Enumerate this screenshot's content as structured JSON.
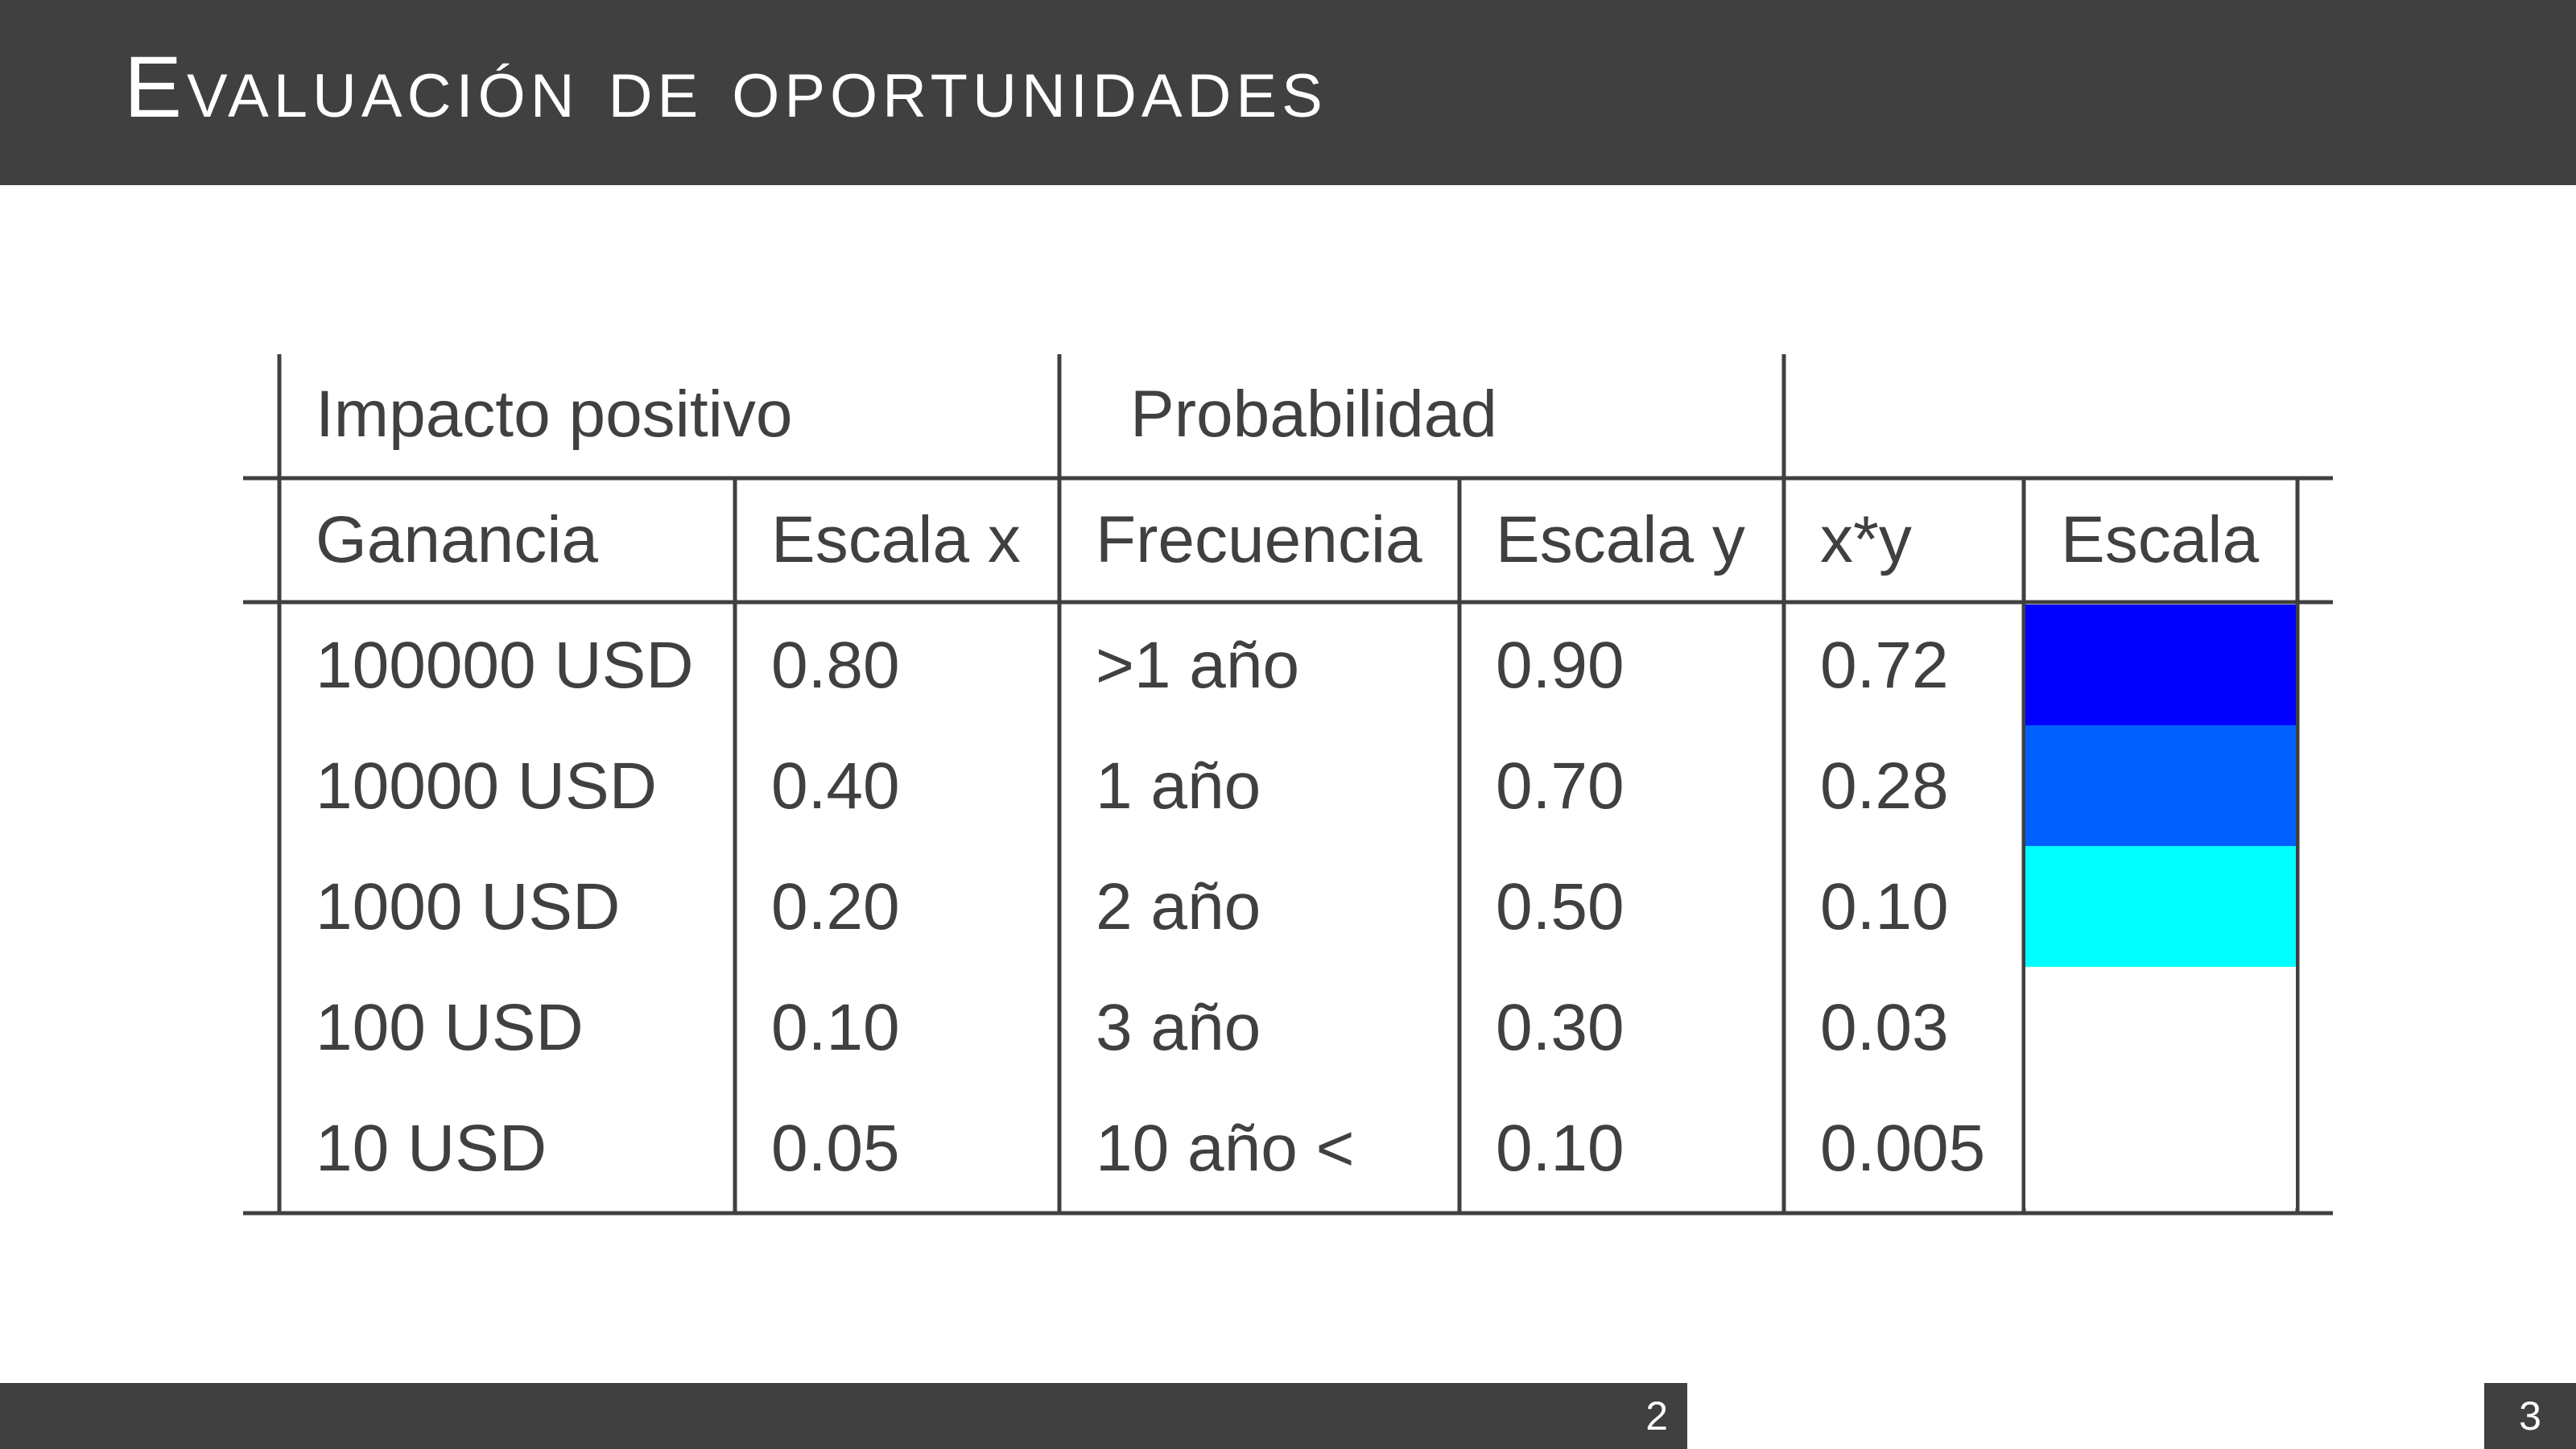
{
  "slide": {
    "title": "Evaluación de oportunidades",
    "page_number": "2",
    "total_pages": "3"
  },
  "table": {
    "group_headers": {
      "impact": "Impacto positivo",
      "probability": "Probabilidad"
    },
    "columns": [
      "Ganancia",
      "Escala x",
      "Frecuencia",
      "Escala y",
      "x*y",
      "Escala"
    ],
    "rows": [
      {
        "gain": "100000 USD",
        "scale_x": "0.80",
        "frequency": ">1 año",
        "scale_y": "0.90",
        "xy": "0.72"
      },
      {
        "gain": "10000 USD",
        "scale_x": "0.40",
        "frequency": "1 año",
        "scale_y": "0.70",
        "xy": "0.28"
      },
      {
        "gain": "1000 USD",
        "scale_x": "0.20",
        "frequency": "2 año",
        "scale_y": "0.50",
        "xy": "0.10"
      },
      {
        "gain": "100 USD",
        "scale_x": "0.10",
        "frequency": "3 año",
        "scale_y": "0.30",
        "xy": "0.03"
      },
      {
        "gain": "10 USD",
        "scale_x": "0.05",
        "frequency": "10 año <",
        "scale_y": "0.10",
        "xy": "0.005"
      }
    ],
    "scale_colors": [
      "#0000ff",
      "#0060ff",
      "#00ffff",
      "#ffffff",
      "#ffffff"
    ],
    "line_color": "#404040"
  }
}
